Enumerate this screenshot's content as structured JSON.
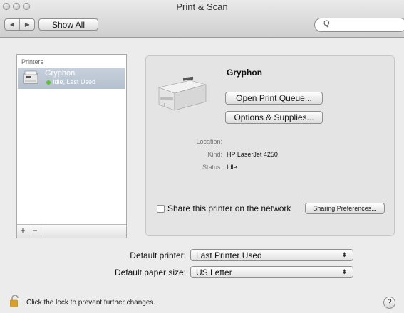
{
  "window": {
    "title": "Print & Scan"
  },
  "toolbar": {
    "back_glyph": "◀",
    "forward_glyph": "▶",
    "show_all_label": "Show All",
    "search_glyph": "Q"
  },
  "printers": {
    "header": "Printers",
    "items": [
      {
        "name": "Gryphon",
        "status": "Idle, Last Used",
        "status_color": "#5bc236"
      }
    ],
    "add_glyph": "+",
    "remove_glyph": "−"
  },
  "detail": {
    "name": "Gryphon",
    "open_queue_label": "Open Print Queue...",
    "options_supplies_label": "Options & Supplies...",
    "location_label": "Location:",
    "location_value": "",
    "kind_label": "Kind:",
    "kind_value": "HP LaserJet 4250",
    "status_label": "Status:",
    "status_value": "Idle",
    "share_label": "Share this printer on the network",
    "share_checked": false,
    "sharing_prefs_label": "Sharing Preferences..."
  },
  "defaults": {
    "printer_label": "Default printer:",
    "printer_value": "Last Printer Used",
    "paper_label": "Default paper size:",
    "paper_value": "US Letter",
    "arrows_glyph": "⬍"
  },
  "footer": {
    "lock_text": "Click the lock to prevent further changes.",
    "help_glyph": "?"
  }
}
